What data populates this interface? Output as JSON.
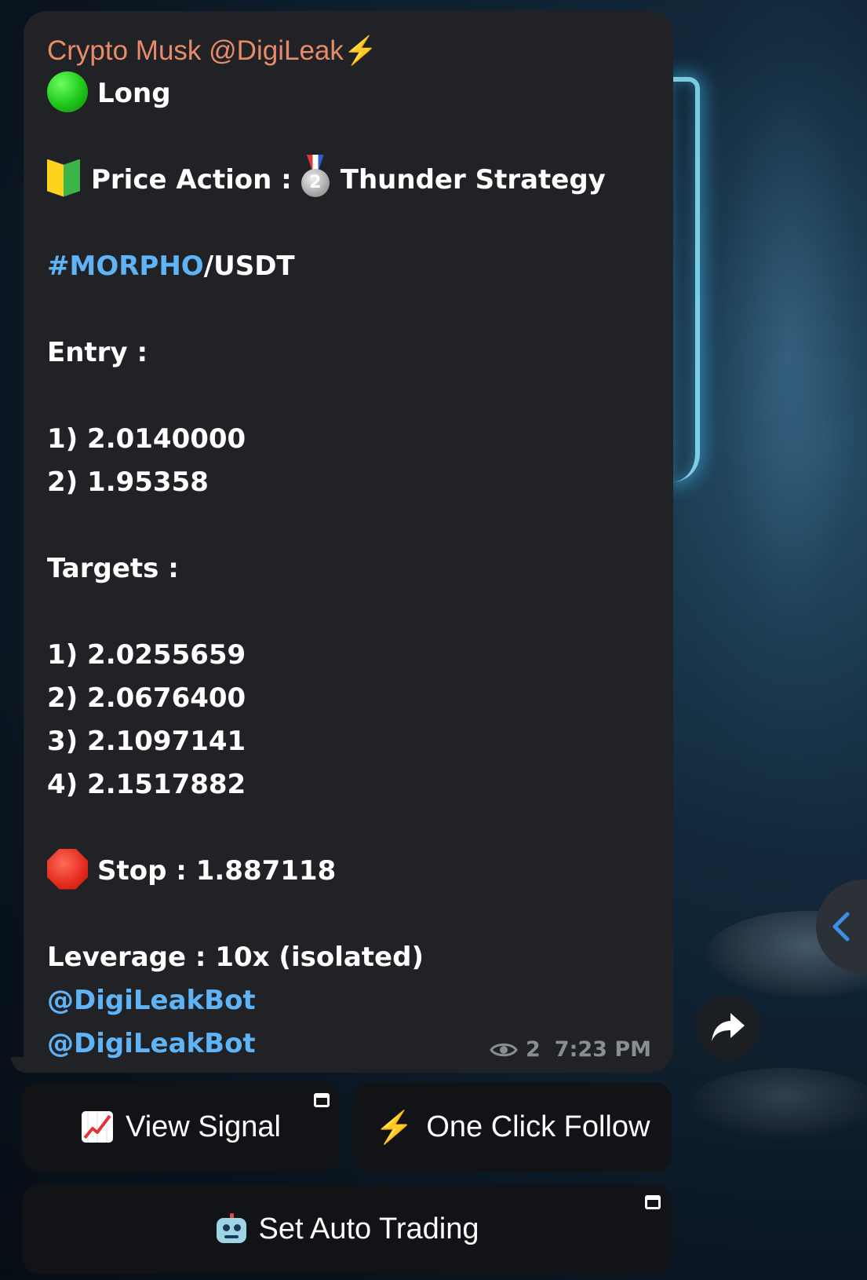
{
  "message": {
    "sender": "Crypto Musk @DigiLeak",
    "sender_bolt": "⚡",
    "direction": "Long",
    "price_action_label": "Price Action :",
    "strategy": "Thunder Strategy",
    "medal_number": "2",
    "pair_hashtag": "#MORPHO",
    "pair_quote": "/USDT",
    "entry_label": "Entry :",
    "entries": [
      "1) 2.0140000",
      "2) 1.95358"
    ],
    "targets_label": "Targets :",
    "targets": [
      "1) 2.0255659",
      "2) 2.0676400",
      "3) 2.1097141",
      "4) 2.1517882"
    ],
    "stop": "Stop : 1.887118",
    "leverage": "Leverage : 10x (isolated)",
    "mentions": [
      "@DigiLeakBot",
      "@DigiLeakBot"
    ],
    "views": "2",
    "time": "7:23 PM"
  },
  "buttons": {
    "view_signal": "View Signal",
    "one_click_follow": "One Click Follow",
    "set_auto_trading": "Set Auto Trading"
  },
  "icons": {
    "status": "green-circle-icon",
    "beginner": "japanese-beginner-icon",
    "medal": "second-place-medal-icon",
    "stop": "stop-sign-icon",
    "views": "eye-icon",
    "view_signal": "chart-increasing-icon",
    "follow": "lightning-icon",
    "auto_trading": "robot-icon",
    "link_indicator": "open-window-icon",
    "share": "share-arrow-icon",
    "side_panel": "chevron-left-icon"
  },
  "colors": {
    "bubble": "#212226",
    "sender": "#e88b6b",
    "link": "#5fb4f7",
    "button_bg": "#121316",
    "meta": "#8a8d93"
  }
}
